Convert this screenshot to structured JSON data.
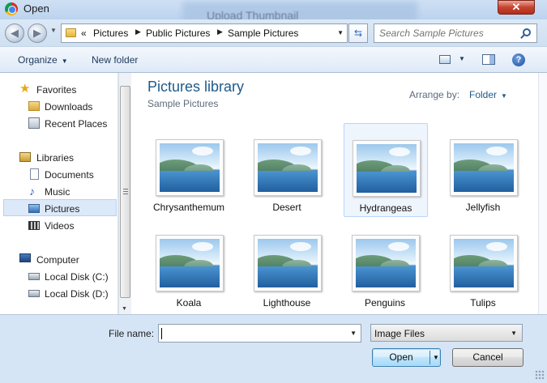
{
  "window": {
    "title": "Open",
    "background_title": "Upload Thumbnail",
    "close_glyph": "✕"
  },
  "address": {
    "overflow_glyph": "«",
    "crumbs": [
      "Pictures",
      "Public Pictures",
      "Sample Pictures"
    ],
    "search_placeholder": "Search Sample Pictures"
  },
  "toolbar": {
    "organize": "Organize",
    "new_folder": "New folder"
  },
  "nav": {
    "favorites_header": "Favorites",
    "favorites": [
      "Downloads",
      "Recent Places"
    ],
    "libraries_header": "Libraries",
    "libraries": [
      "Documents",
      "Music",
      "Pictures",
      "Videos"
    ],
    "computer_header": "Computer",
    "drives": [
      "Local Disk (C:)",
      "Local Disk (D:)"
    ],
    "selected": "Pictures"
  },
  "library": {
    "title": "Pictures library",
    "subtitle": "Sample Pictures",
    "arrange_label": "Arrange by:",
    "arrange_value": "Folder"
  },
  "files": [
    "Chrysanthemum",
    "Desert",
    "Hydrangeas",
    "Jellyfish",
    "Koala",
    "Lighthouse",
    "Penguins",
    "Tulips"
  ],
  "hovered_file": "Hydrangeas",
  "footer": {
    "file_name_label": "File name:",
    "file_name_value": "",
    "file_type": "Image Files",
    "open": "Open",
    "cancel": "Cancel"
  },
  "colors": {
    "accent_title": "#1e5a8b",
    "selection": "#dce9f9",
    "chrome": "#d6e5f5"
  }
}
